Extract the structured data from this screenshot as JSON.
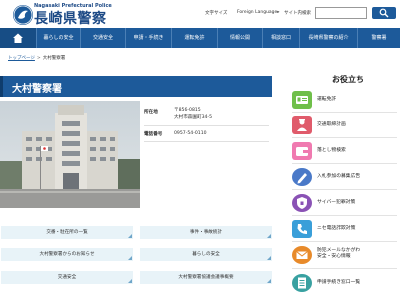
{
  "header": {
    "logo_en": "Nagasaki Prefectural Police",
    "logo_ja": "長崎県警察",
    "font_size_label": "文字サイズ",
    "language_label": "Foreign Language▸",
    "site_search_label": "サイト内検索",
    "search_value": ""
  },
  "nav": {
    "home_icon": "home-icon",
    "items": [
      "暮らしの安全",
      "交通安全",
      "申請・手続き",
      "運転免許",
      "情報公開",
      "相談窓口",
      "長崎県警察の紹介",
      "警察署"
    ]
  },
  "breadcrumb": {
    "home": "トップページ",
    "separator": ">",
    "current": "大村警察署"
  },
  "page": {
    "title": "大村警察署"
  },
  "station": {
    "location_label": "所在地",
    "postal_code": "〒856-0815",
    "address": "大村市森園町34-5",
    "phone_label": "電話番号",
    "phone": "0957-54-0110"
  },
  "links": [
    "交番・駐在所の一覧",
    "事件・事故統計",
    "大村警察署からのお知らせ",
    "暮らしの安全",
    "交通安全",
    "大村警察署協議会議事概要"
  ],
  "sidebar": {
    "title": "お役立ち",
    "items": [
      {
        "label": "運転免許",
        "icon": "license-card-icon",
        "color": "#6fbf4a"
      },
      {
        "label": "交通取締計画",
        "icon": "traffic-police-icon",
        "color": "#e05b6b"
      },
      {
        "label": "落とし物検索",
        "icon": "wallet-icon",
        "color": "#f07ab0"
      },
      {
        "label": "入札参加の募集広告",
        "icon": "pen-icon",
        "color": "#4a79c8"
      },
      {
        "label": "サイバー犯罪対策",
        "icon": "shield-icon",
        "color": "#8a52b5"
      },
      {
        "label": "ニセ電話詐欺対策",
        "icon": "phone-icon",
        "color": "#3a9fd9"
      },
      {
        "label": "防犯メールなかがわ安全・安心情報",
        "label_line1": "防犯メールなかがわ",
        "label_line2": "安全・安心情報",
        "icon": "mail-icon",
        "color": "#e88a2a"
      },
      {
        "label": "申請手続き窓口一覧",
        "icon": "document-icon",
        "color": "#39a1a1"
      }
    ]
  },
  "colors": {
    "brand": "#1d5a9a",
    "link_bg": "#e8f3f8"
  }
}
